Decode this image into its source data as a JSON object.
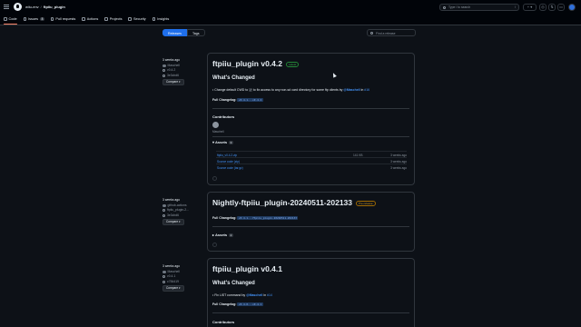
{
  "header": {
    "owner": "wiiu-env",
    "repo": "ftpiiu_plugin",
    "search_placeholder": "Type / to search",
    "search_slash": "/",
    "plus_label": "+ ▾"
  },
  "nav": [
    {
      "label": "Code",
      "active": true
    },
    {
      "label": "Issues",
      "count": "8"
    },
    {
      "label": "Pull requests"
    },
    {
      "label": "Actions"
    },
    {
      "label": "Projects"
    },
    {
      "label": "Security"
    },
    {
      "label": "Insights"
    }
  ],
  "tabs": {
    "releases": "Releases",
    "tags": "Tags"
  },
  "filter_placeholder": "Find a release",
  "releases": [
    {
      "when": "3 weeks ago",
      "author": "Maschell",
      "tag": "v0.4.2",
      "commit": "3e3cbd6",
      "compare": "Compare ▾",
      "title": "ftpiiu_plugin v0.4.2",
      "badge": "Latest",
      "whats_changed": "What's Changed",
      "change_pre": "Change default CWD to ",
      "change_code": "/",
      "change_post": " to fix access to any non-sd card directory for some ftp clients by ",
      "change_author": "@Maschell",
      "change_in": " in ",
      "change_pr": "#16",
      "full_changelog_label": "Full Changelog: ",
      "full_changelog": "v0.4.1...v0.4.2",
      "contributors": "Contributors",
      "contributor": "Maschell",
      "assets_label": "Assets",
      "assets_count": "3",
      "assets": [
        {
          "name": "ftpiiu_v0.4.2.zip",
          "size": "141 KB",
          "date": "3 weeks ago"
        },
        {
          "name": "Source code (zip)",
          "size": "",
          "date": "3 weeks ago"
        },
        {
          "name": "Source code (tar.gz)",
          "size": "",
          "date": "3 weeks ago"
        }
      ]
    },
    {
      "when": "3 weeks ago",
      "author": "github-actions",
      "tag": "ftpiiu_plugin-2...",
      "commit": "3e3cbd6",
      "compare": "Compare ▾",
      "title": "Nightly-ftpiiu_plugin-20240511-202133",
      "badge": "Pre-release",
      "full_changelog_label": "Full Changelog: ",
      "full_changelog": "v0.4.1...ftpiiu_plugin-20240511-202133",
      "assets_label": "Assets",
      "assets_count": "2"
    },
    {
      "when": "3 weeks ago",
      "author": "Maschell",
      "tag": "v0.4.1",
      "commit": "c784419",
      "compare": "Compare ▾",
      "title": "ftpiiu_plugin v0.4.1",
      "whats_changed": "What's Changed",
      "change_pre": "Fix LIST command by ",
      "change_author": "@Maschell",
      "change_in": " in ",
      "change_pr": "#14",
      "full_changelog_label": "Full Changelog: ",
      "full_changelog": "v0.4.0...v0.4.1",
      "contributors": "Contributors"
    }
  ]
}
